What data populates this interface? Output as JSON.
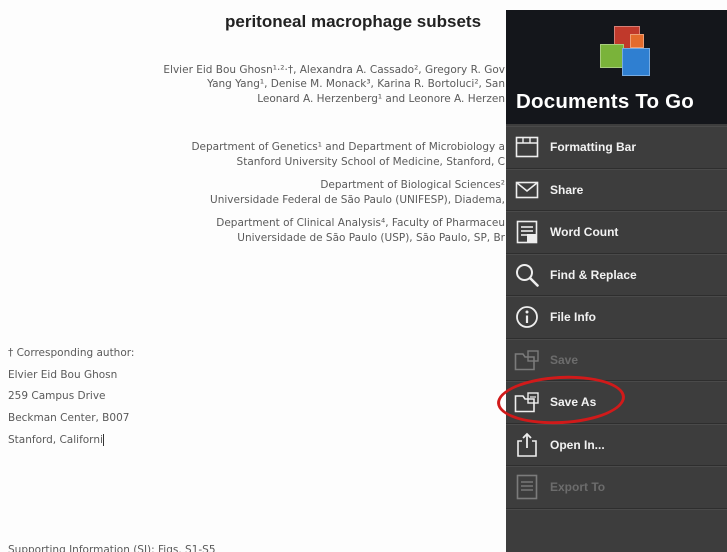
{
  "document": {
    "title": "peritoneal macrophage subsets",
    "authors": [
      "Elvier Eid Bou Ghosn¹·²·†, Alexandra A. Cassado², Gregory R. Gov",
      "Yang Yang¹, Denise M. Monack³, Karina R. Bortoluci², San",
      "Leonard A. Herzenberg¹ and Leonore A. Herzen"
    ],
    "affiliations": [
      "Department of Genetics¹ and Department of Microbiology a",
      "Stanford University School of Medicine, Stanford, C",
      "Department of Biological Sciences²",
      "Universidade Federal de São Paulo (UNIFESP), Diadema,",
      "Department of Clinical Analysis⁴, Faculty of Pharmaceu",
      "Universidade de São Paulo (USP), São Paulo, SP, Br"
    ],
    "correspondence": [
      "† Corresponding author:",
      "Elvier Eid Bou Ghosn",
      "259 Campus Drive",
      "Beckman Center, B007",
      "Stanford, Californi"
    ],
    "footer": "Supporting Information (SI): Figs. S1-S5"
  },
  "panel": {
    "brand": "Documents To Go",
    "menu_items": [
      {
        "label": "Formatting Bar",
        "icon": "formatting-bar-icon",
        "enabled": true
      },
      {
        "label": "Share",
        "icon": "envelope-icon",
        "enabled": true
      },
      {
        "label": "Word Count",
        "icon": "word-count-icon",
        "enabled": true
      },
      {
        "label": "Find & Replace",
        "icon": "magnifier-icon",
        "enabled": true
      },
      {
        "label": "File Info",
        "icon": "info-icon",
        "enabled": true
      },
      {
        "label": "Save",
        "icon": "folder-save-icon",
        "enabled": false
      },
      {
        "label": "Save As",
        "icon": "folder-save-as-icon",
        "enabled": true,
        "highlighted": true
      },
      {
        "label": "Open In...",
        "icon": "share-out-icon",
        "enabled": true
      },
      {
        "label": "Export To",
        "icon": "export-icon",
        "enabled": false
      }
    ],
    "highlight_color": "#d11a1a"
  }
}
